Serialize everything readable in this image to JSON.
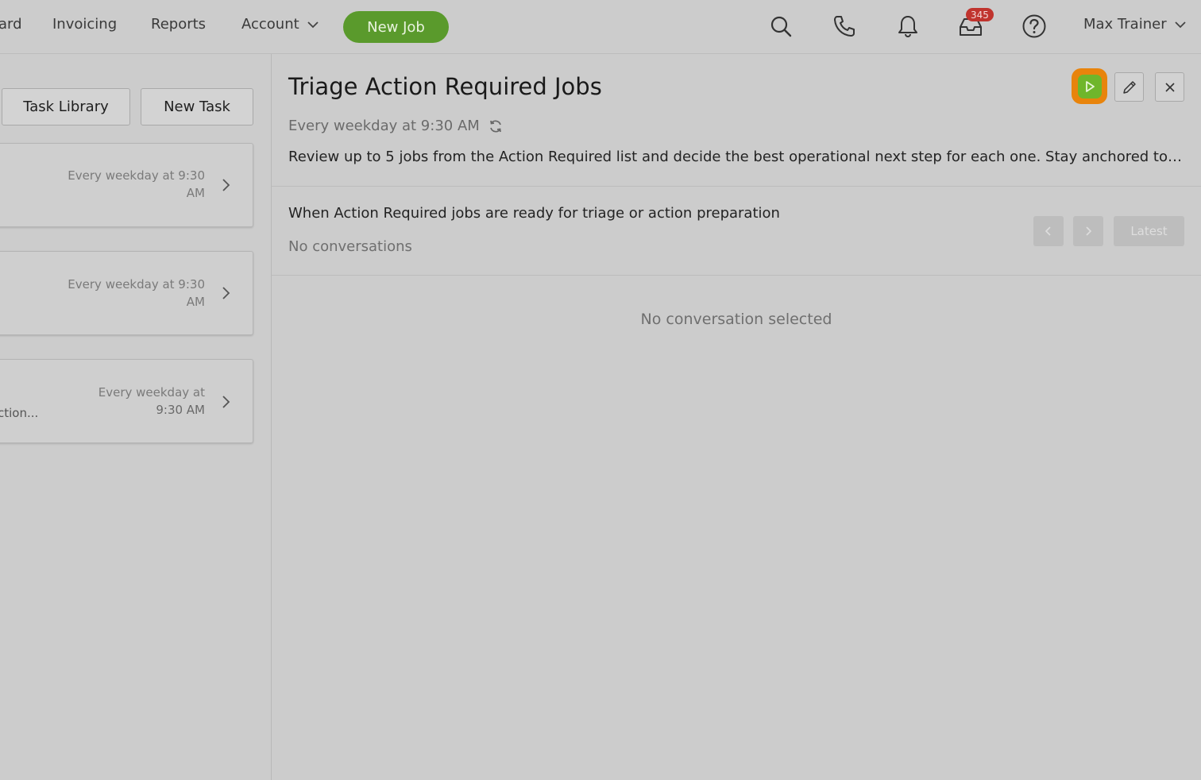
{
  "nav": {
    "items": [
      "ard",
      "Invoicing",
      "Reports"
    ],
    "account_label": "Account",
    "new_job_label": "New Job",
    "inbox_badge": "345",
    "user_name": "Max Trainer"
  },
  "left": {
    "task_library_label": "Task Library",
    "new_task_label": "New Task",
    "cards": [
      {
        "schedule_line1": "Every weekday at 9:30",
        "schedule_line2": "AM",
        "name": ""
      },
      {
        "schedule_line1": "Every weekday at 9:30",
        "schedule_line2": "AM",
        "name": ""
      },
      {
        "schedule_line1": "Every weekday at",
        "schedule_line2": "9:30 AM",
        "name": "ction..."
      }
    ]
  },
  "detail": {
    "title": "Triage Action Required Jobs",
    "schedule": "Every weekday at 9:30 AM",
    "description": "Review up to 5 jobs from the Action Required list and decide the best operational next step for each one. Stay anchored to t...",
    "trigger": "When Action Required jobs are ready for triage or action preparation",
    "no_conversations": "No conversations",
    "latest_label": "Latest",
    "empty_state": "No conversation selected"
  },
  "icons": [
    "search-icon",
    "phone-icon",
    "bell-icon",
    "inbox-icon",
    "help-icon",
    "chevron-down-icon",
    "refresh-icon",
    "play-icon",
    "pencil-icon",
    "close-icon",
    "chevron-left-icon",
    "chevron-right-icon"
  ],
  "colors": {
    "new_job": "#5a9a2c",
    "badge": "#c0342e",
    "play_ring": "#e8840c",
    "play_fill": "#6fb62b"
  }
}
